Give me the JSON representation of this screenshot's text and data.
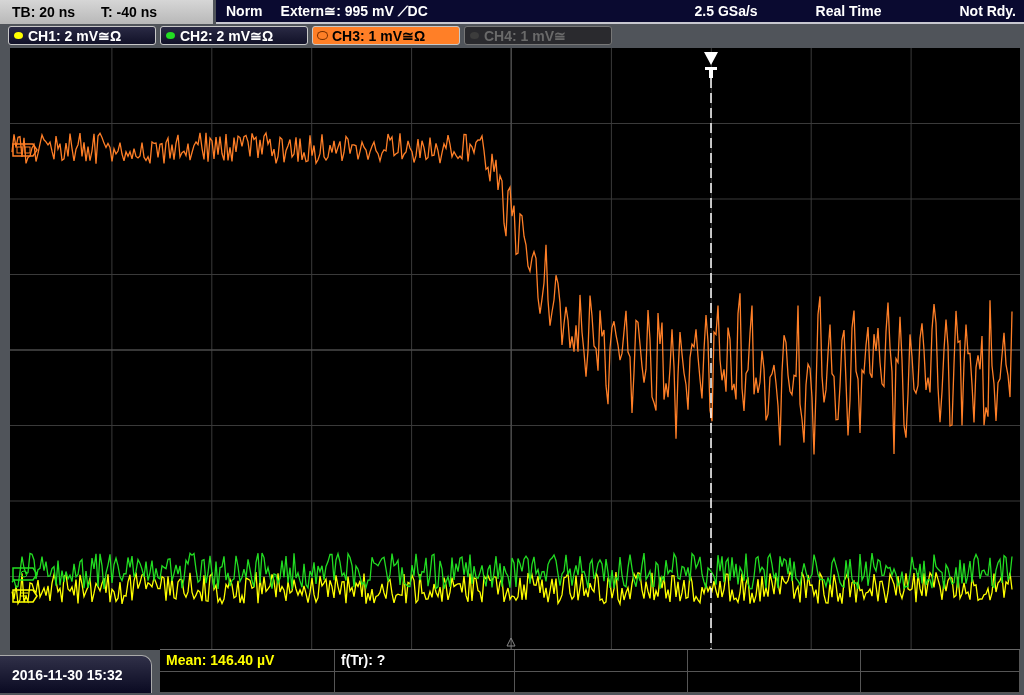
{
  "header": {
    "timebase": "TB: 20 ns",
    "trigger_time": "T: -40 ns",
    "trigger_mode": "Norm",
    "trigger_source": "Extern≅: 995 mV ⟋DC",
    "sample_rate": "2.5 GSa/s",
    "acquisition": "Real Time",
    "status": "Not Rdy."
  },
  "channels": [
    {
      "label": "CH1: 2 mV≅Ω",
      "color": "#ffff00",
      "on": true,
      "selected": false
    },
    {
      "label": "CH2: 2 mV≅Ω",
      "color": "#22dd22",
      "on": true,
      "selected": false
    },
    {
      "label": "CH3: 1 mV≅Ω",
      "color": "#ff7f27",
      "on": true,
      "selected": true
    },
    {
      "label": "CH4: 1 mV≅",
      "color": "#3c3c3c",
      "on": false,
      "selected": false
    }
  ],
  "measurements": [
    {
      "label": "Mean: 146.40 µV",
      "color": "#ffff00"
    },
    {
      "label": "f(Tr): ?",
      "color": "#ffffff"
    }
  ],
  "datetime": "2016-11-30 15:32"
}
